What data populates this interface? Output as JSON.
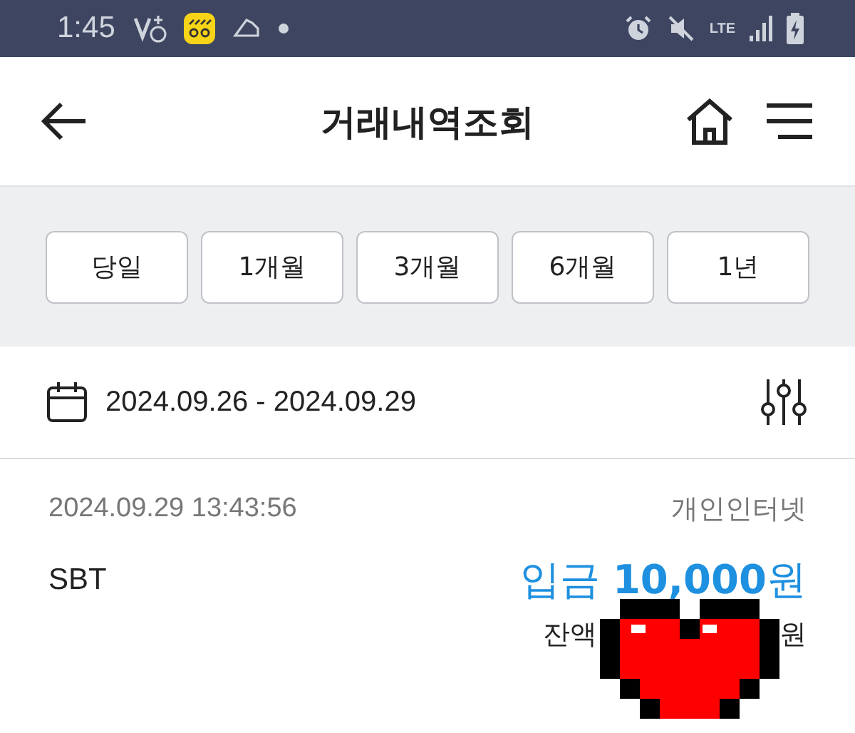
{
  "status_bar": {
    "time": "1:45",
    "network": "LTE"
  },
  "header": {
    "title": "거래내역조회"
  },
  "period_buttons": [
    {
      "label": "당일"
    },
    {
      "label": "1개월"
    },
    {
      "label": "3개월"
    },
    {
      "label": "6개월"
    },
    {
      "label": "1년"
    }
  ],
  "date_range": {
    "text": "2024.09.26 - 2024.09.29"
  },
  "transactions": [
    {
      "datetime": "2024.09.29 13:43:56",
      "channel": "개인인터넷",
      "name": "SBT",
      "amount": "입금 **10,000**원",
      "balance_label": "잔액",
      "balance_unit": "원"
    }
  ]
}
